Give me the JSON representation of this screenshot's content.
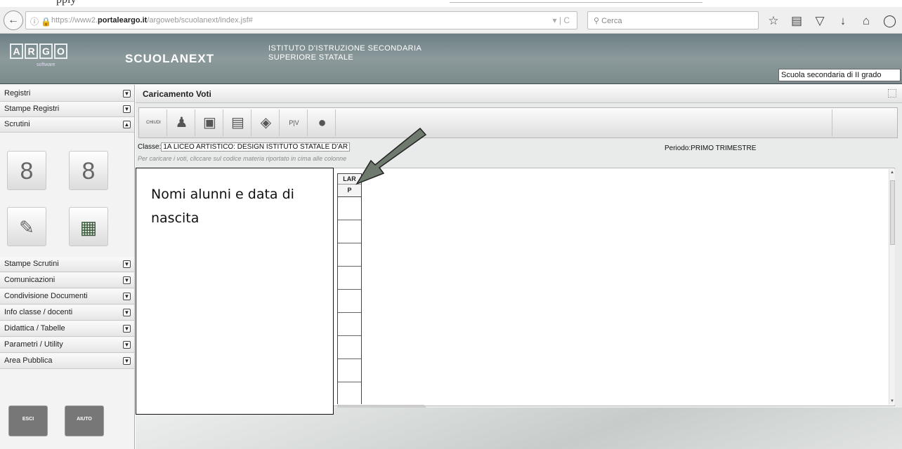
{
  "browser": {
    "url_prefix": "https://www2.",
    "url_domain": "portaleargo.it",
    "url_path": "/argoweb/scuolanext/index.jsf#",
    "search_placeholder": "Cerca",
    "reload": "C"
  },
  "header": {
    "logo": [
      "A",
      "R",
      "G",
      "O"
    ],
    "logo_sub": "software",
    "brand": "SCUOLANEXT",
    "institute_line1": "ISTITUTO D'ISTRUZIONE SECONDARIA",
    "institute_line2": "SUPERIORE STATALE",
    "school_select": "Scuola secondaria di II grado"
  },
  "sidebar": {
    "top_items": [
      {
        "label": "Registri"
      },
      {
        "label": "Stampe Registri"
      },
      {
        "label": "Scrutini"
      }
    ],
    "icon_labels": [
      "8",
      "8"
    ],
    "bottom_items": [
      {
        "label": "Stampe Scrutini"
      },
      {
        "label": "Comunicazioni"
      },
      {
        "label": "Condivisione Documenti"
      },
      {
        "label": "Info classe / docenti"
      },
      {
        "label": "Didattica / Tabelle"
      },
      {
        "label": "Parametri / Utility"
      },
      {
        "label": "Area Pubblica"
      }
    ],
    "exit_label": "ESCI",
    "help_label": "AIUTO"
  },
  "main": {
    "title": "Caricamento Voti",
    "toolbar": {
      "chiudi": "CHIUDI"
    },
    "classe_label": "Classe:",
    "classe_value": "1A LICEO ARTISTICO: DESIGN ISTITUTO STATALE D'AR",
    "periodo": "Periodo:PRIMO TRIMESTRE",
    "hint": "Per caricare i voti, cliccare sul codice materia riportato in cima alle colonne",
    "column": {
      "code": "LAR",
      "type": "P"
    }
  },
  "annotation": {
    "text": "Nomi alunni e data di nascita",
    "colors": {
      "arrow": "#6f7a6f",
      "border": "#111111"
    }
  }
}
